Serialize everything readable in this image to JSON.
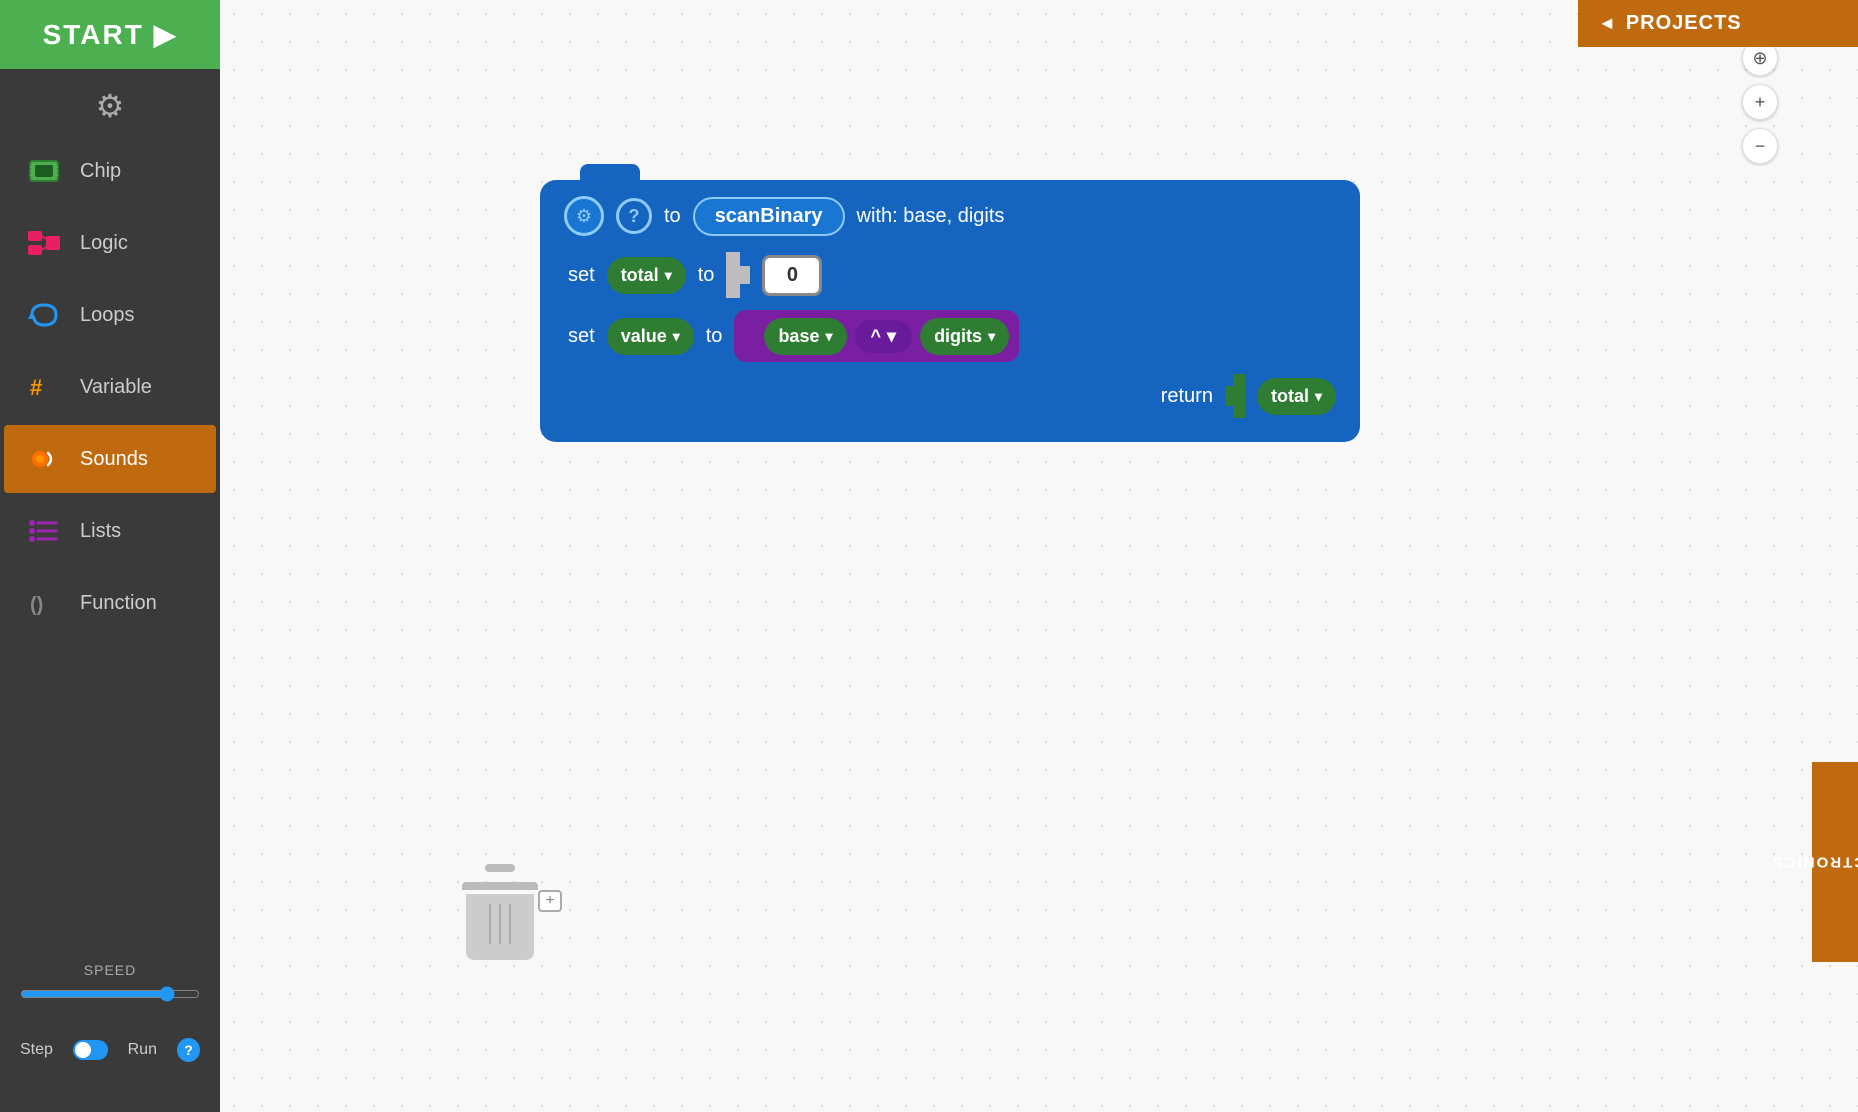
{
  "sidebar": {
    "start_label": "START",
    "start_arrow": "▶",
    "items": [
      {
        "id": "chip",
        "label": "Chip",
        "icon": "chip-icon",
        "active": false
      },
      {
        "id": "logic",
        "label": "Logic",
        "icon": "logic-icon",
        "active": false
      },
      {
        "id": "loops",
        "label": "Loops",
        "icon": "loops-icon",
        "active": false
      },
      {
        "id": "variable",
        "label": "Variable",
        "icon": "variable-icon",
        "active": false
      },
      {
        "id": "sounds",
        "label": "Sounds",
        "icon": "sounds-icon",
        "active": true
      },
      {
        "id": "lists",
        "label": "Lists",
        "icon": "lists-icon",
        "active": false
      },
      {
        "id": "function",
        "label": "Function",
        "icon": "function-icon",
        "active": false
      }
    ],
    "speed": {
      "label": "SPEED",
      "value": 85
    },
    "step_label": "Step",
    "run_label": "Run",
    "help_label": "?"
  },
  "workspace": {
    "zoom_controls": {
      "crosshair": "⊕",
      "plus": "+",
      "minus": "−"
    },
    "block": {
      "gear_icon": "⚙",
      "help_icon": "?",
      "to_keyword": "to",
      "fn_name": "scanBinary",
      "with_text": "with: base, digits",
      "set1": {
        "set_keyword": "set",
        "var_name": "total",
        "to_keyword": "to",
        "value": "0"
      },
      "set2": {
        "set_keyword": "set",
        "var_name": "value",
        "to_keyword": "to",
        "base_var": "base",
        "op": "^",
        "digits_var": "digits"
      },
      "return_row": {
        "return_keyword": "return",
        "var_name": "total"
      }
    }
  },
  "projects": {
    "arrow": "◄",
    "label": "PROJECTS"
  },
  "electronics": {
    "label": "ELECTRONICS"
  },
  "trash": {
    "plus": "+"
  }
}
